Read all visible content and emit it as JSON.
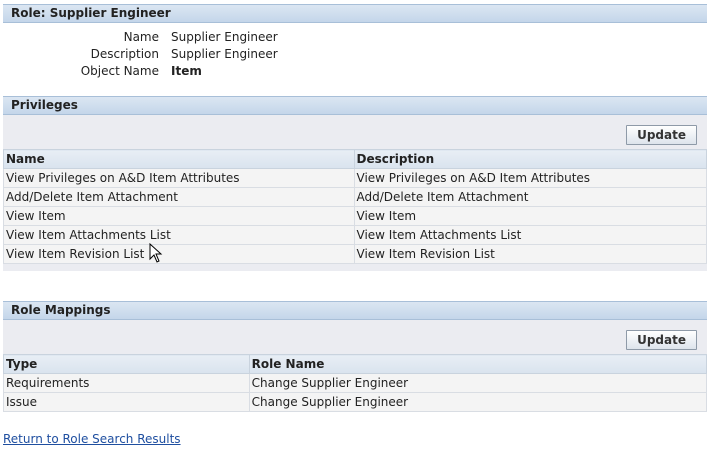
{
  "role_header": {
    "title": "Role: Supplier Engineer"
  },
  "properties": [
    {
      "label": "Name",
      "value": "Supplier Engineer"
    },
    {
      "label": "Description",
      "value": "Supplier Engineer"
    },
    {
      "label": "Object Name",
      "value": "Item"
    }
  ],
  "privileges": {
    "title": "Privileges",
    "update_label": "Update",
    "columns": [
      "Name",
      "Description"
    ],
    "rows": [
      [
        "View Privileges on A&D Item Attributes",
        "View Privileges on A&D Item Attributes"
      ],
      [
        "Add/Delete Item Attachment",
        "Add/Delete Item Attachment"
      ],
      [
        "View Item",
        "View Item"
      ],
      [
        "View Item Attachments List",
        "View Item Attachments List"
      ],
      [
        "View Item Revision List",
        "View Item Revision List"
      ]
    ]
  },
  "role_mappings": {
    "title": "Role Mappings",
    "update_label": "Update",
    "columns": [
      "Type",
      "Role Name"
    ],
    "rows": [
      [
        "Requirements",
        "Change Supplier Engineer"
      ],
      [
        "Issue",
        "Change Supplier Engineer"
      ]
    ]
  },
  "footer": {
    "return_link": "Return to Role Search Results"
  },
  "colors": {
    "header_bg": "#c4d6ea",
    "panel_bg": "#ebecf1",
    "link": "#1f4fa0"
  },
  "icons": {
    "cursor": "mouse-pointer-icon"
  }
}
